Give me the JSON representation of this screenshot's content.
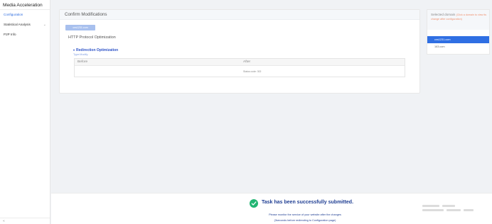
{
  "sidebar": {
    "title": "Media Acceleration",
    "items": [
      {
        "label": "Configuration",
        "active": true
      },
      {
        "label": "Statistical Analysis",
        "expandable": true
      },
      {
        "label": "P2P Info"
      }
    ],
    "collapse_icon": "collapse-icon"
  },
  "main": {
    "header": "Confirm Modifications",
    "domain_tag": "cns1231.com",
    "section_title": "HTTP Protocol Optimization",
    "subsection": {
      "title": "Redirection Optimization",
      "type": "Type:Modify"
    },
    "table": {
      "columns": [
        "Before",
        "After"
      ],
      "rows": [
        [
          "",
          "Status code: 302"
        ]
      ]
    }
  },
  "side_panel": {
    "title": "Selected domain",
    "hint": "(Click a domain to view its change after configuration)",
    "domains": [
      {
        "label": "cns1231.com",
        "active": true
      },
      {
        "label": "163.com",
        "active": false
      }
    ]
  },
  "footer": {
    "status_icon": "check-circle-icon",
    "title": "Task has been successfully submitted.",
    "line1": "Please monitor the service of your website after the changes",
    "line2": "(3seconds before redirecting to Configuration page)"
  },
  "colors": {
    "accent": "#2f6fe3",
    "success": "#22b573",
    "link": "#2f54c8",
    "hint": "#f0916f"
  }
}
